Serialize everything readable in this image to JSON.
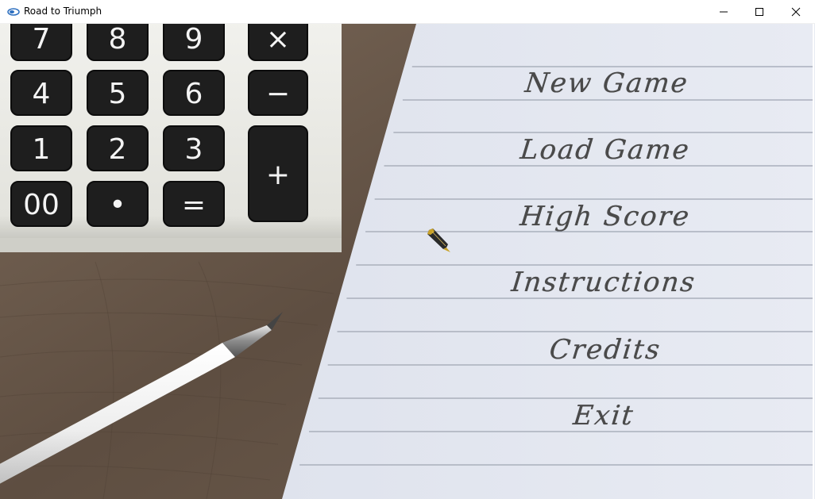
{
  "window": {
    "title": "Road to Triumph",
    "controls": [
      "minimize-icon",
      "maximize-icon",
      "close-icon"
    ]
  },
  "menu": {
    "items": [
      {
        "label": "New Game"
      },
      {
        "label": "Load Game"
      },
      {
        "label": "High Score"
      },
      {
        "label": "Instructions"
      },
      {
        "label": "Credits"
      },
      {
        "label": "Exit"
      }
    ]
  },
  "calculator": {
    "keys": [
      "7",
      "8",
      "9",
      "×",
      "4",
      "5",
      "6",
      "−",
      "1",
      "2",
      "3",
      "+",
      "00",
      "•",
      "="
    ]
  },
  "colors": {
    "paper": "#e4e8f1",
    "desk": "#6b5a4c",
    "menu_text": "#4a4a4a"
  },
  "cursor": "fountain-pen-icon"
}
